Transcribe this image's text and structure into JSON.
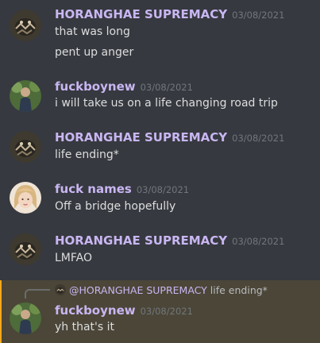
{
  "messages": [
    {
      "author": "HORANGHAE SUPREMACY",
      "time": "03/08/2021",
      "avatar": "tiger-avatar",
      "lines": [
        "that was long",
        "pent up anger"
      ]
    },
    {
      "author": "fuckboynew",
      "time": "03/08/2021",
      "avatar": "person-outdoor-avatar",
      "lines": [
        "i will take us on a life changing road trip"
      ]
    },
    {
      "author": "HORANGHAE SUPREMACY",
      "time": "03/08/2021",
      "avatar": "tiger-avatar",
      "lines": [
        "life ending*"
      ]
    },
    {
      "author": "fuck names",
      "time": "03/08/2021",
      "avatar": "blonde-person-avatar",
      "lines": [
        "Off a bridge hopefully"
      ]
    },
    {
      "author": "HORANGHAE SUPREMACY",
      "time": "03/08/2021",
      "avatar": "tiger-avatar",
      "lines": [
        "LMFAO"
      ]
    },
    {
      "author": "fuckboynew",
      "time": "03/08/2021",
      "avatar": "person-outdoor-avatar",
      "lines": [
        "yh that's it"
      ],
      "reply": {
        "author": "@HORANGHAE SUPREMACY",
        "text": "life ending*"
      }
    }
  ],
  "colors": {
    "background": "#36393f",
    "author": "#c9b6f2",
    "text": "#dcddde",
    "timestamp": "#72767d",
    "mention_highlight": "#4b4638",
    "mention_bar": "#faa81a"
  }
}
